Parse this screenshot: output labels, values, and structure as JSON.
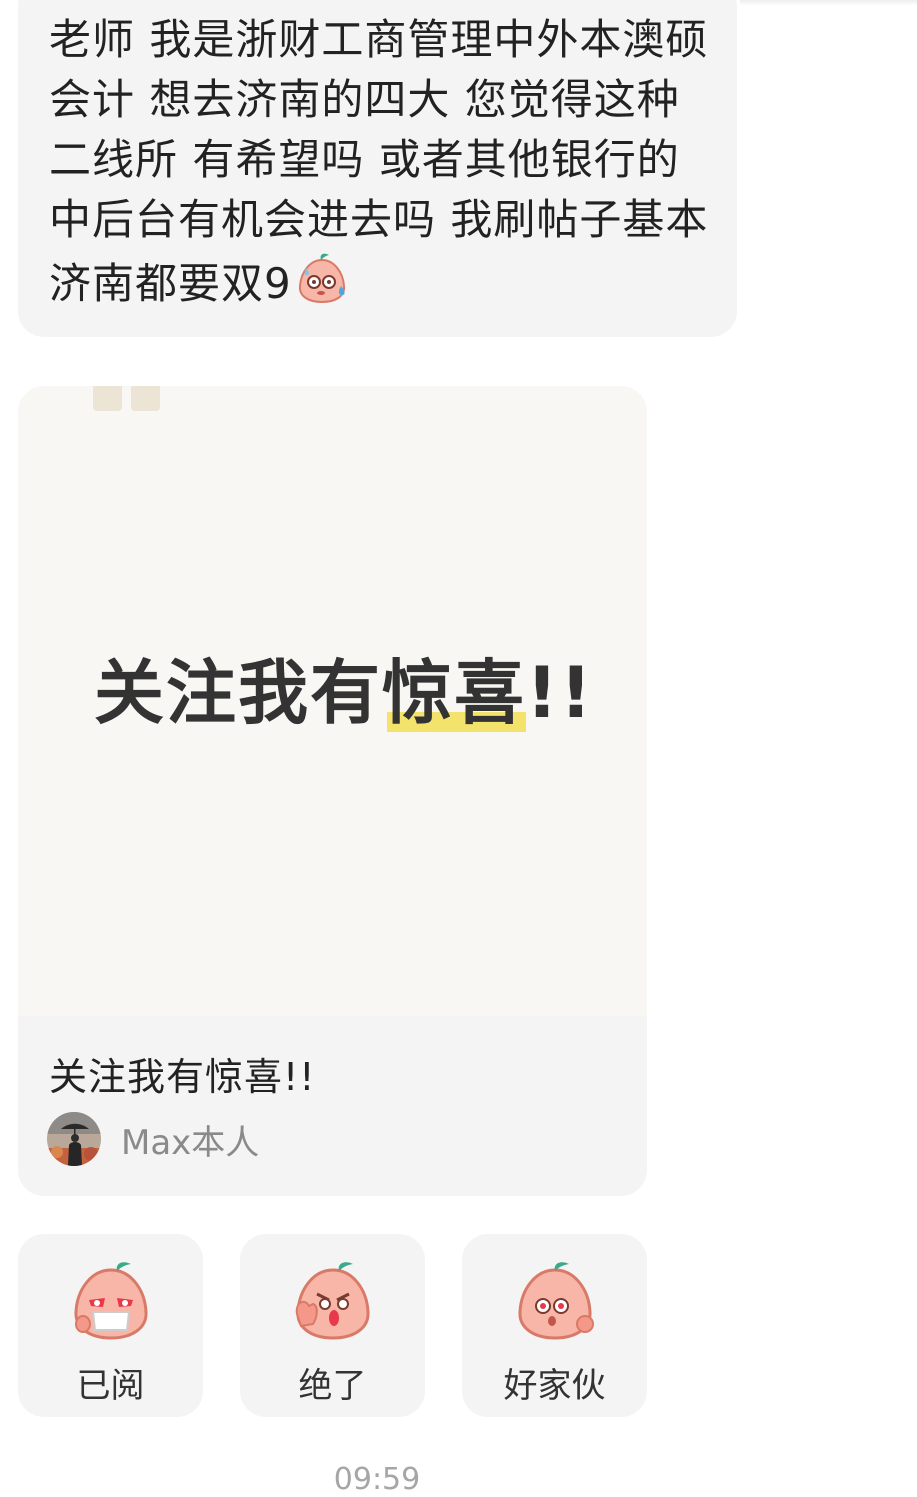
{
  "message": {
    "text": "老师 我是浙财工商管理中外本澳硕会计 想去济南的四大 您觉得这种二线所 有希望吗 或者其他银行的中后台有机会进去吗 我刷帖子基本济南都要双9",
    "trailing_emoji": "sweat-peach-emoji"
  },
  "note_card": {
    "cover_text": "关注我有惊喜!!",
    "title": "关注我有惊喜!!",
    "author": "Max本人",
    "highlight_color": "#f3e26b"
  },
  "reactions": [
    {
      "label": "已阅",
      "icon": "masked-peach-emoji"
    },
    {
      "label": "绝了",
      "icon": "thumbs-up-peach-emoji"
    },
    {
      "label": "好家伙",
      "icon": "shocked-peach-emoji"
    }
  ],
  "timestamp": "09:59"
}
